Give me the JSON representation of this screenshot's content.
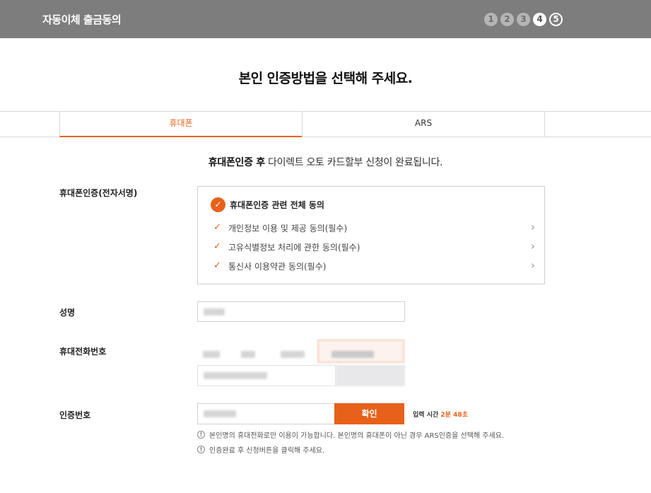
{
  "header": {
    "title": "자동이체 출금동의",
    "steps": [
      "1",
      "2",
      "3",
      "4",
      "5"
    ]
  },
  "page_heading": "본인 인증방법을 선택해 주세요.",
  "tabs": [
    {
      "label": "휴대폰"
    },
    {
      "label": "ARS"
    }
  ],
  "notice": {
    "bold": "휴대폰인증 후",
    "rest": " 다이렉트 오토 카드할부 신청이 완료됩니다."
  },
  "agreement": {
    "label": "휴대폰인증(전자서명)",
    "all_label": "휴대폰인증 관련 전체 동의",
    "items": [
      {
        "label": "개인정보 이용 및 제공 동의(필수)"
      },
      {
        "label": "고유식별정보 처리에 관한 동의(필수)"
      },
      {
        "label": "통신사 이용약관 동의(필수)"
      }
    ]
  },
  "name_field": {
    "label": "성명"
  },
  "phone_field": {
    "label": "휴대전화번호"
  },
  "auth_field": {
    "label": "인증번호",
    "confirm_label": "확인",
    "timer_label": "입력 시간",
    "timer_value": "2분 48초"
  },
  "info_lines": [
    "본인명의 휴대전화로만 이용이 가능합니다. 본인명의 휴대폰이 아닌 경우 ARS인증을 선택해 주세요.",
    "인증완료 후 신청버튼을 클릭해 주세요."
  ],
  "colors": {
    "accent": "#e8611b",
    "header_bg": "#7d7d7d"
  }
}
